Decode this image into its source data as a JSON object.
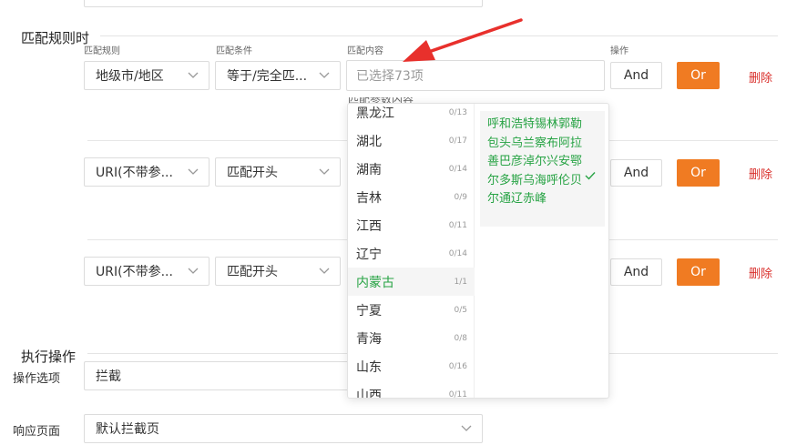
{
  "match_rules": {
    "section_title": "匹配规则时",
    "col_rule": "匹配规则",
    "col_condition": "匹配条件",
    "col_content": "匹配内容",
    "col_action": "操作",
    "rows": [
      {
        "rule": "地级市/地区",
        "condition": "等于/完全匹...",
        "content_placeholder": "已选择73项",
        "and_label": "And",
        "or_label": "Or",
        "delete_label": "删除"
      },
      {
        "rule": "URI(不带参...",
        "condition": "匹配开头",
        "and_label": "And",
        "or_label": "Or",
        "delete_label": "删除"
      },
      {
        "rule": "URI(不带参...",
        "condition": "匹配开头",
        "and_label": "And",
        "or_label": "Or",
        "delete_label": "删除"
      }
    ]
  },
  "dropdown": {
    "provinces": [
      {
        "name": "黑龙江",
        "count": "0/13"
      },
      {
        "name": "湖北",
        "count": "0/17"
      },
      {
        "name": "湖南",
        "count": "0/14"
      },
      {
        "name": "吉林",
        "count": "0/9"
      },
      {
        "name": "江西",
        "count": "0/11"
      },
      {
        "name": "辽宁",
        "count": "0/14"
      },
      {
        "name": "内蒙古",
        "count": "1/1"
      },
      {
        "name": "宁夏",
        "count": "0/5"
      },
      {
        "name": "青海",
        "count": "0/8"
      },
      {
        "name": "山东",
        "count": "0/16"
      },
      {
        "name": "山西",
        "count": "0/11"
      }
    ],
    "selected_city_group": "呼和浩特锡林郭勒包头乌兰察布阿拉善巴彦淖尔兴安鄂尔多斯乌海呼伦贝尔通辽赤峰"
  },
  "actions": {
    "section_title": "执行操作",
    "option_label": "操作选项",
    "option_value": "拦截",
    "response_label": "响应页面",
    "response_value": "默认拦截页"
  },
  "colors": {
    "accent_orange": "#f07b22",
    "delete_red": "#d9302c",
    "selected_green": "#27a344",
    "arrow_red": "#e8302c"
  }
}
